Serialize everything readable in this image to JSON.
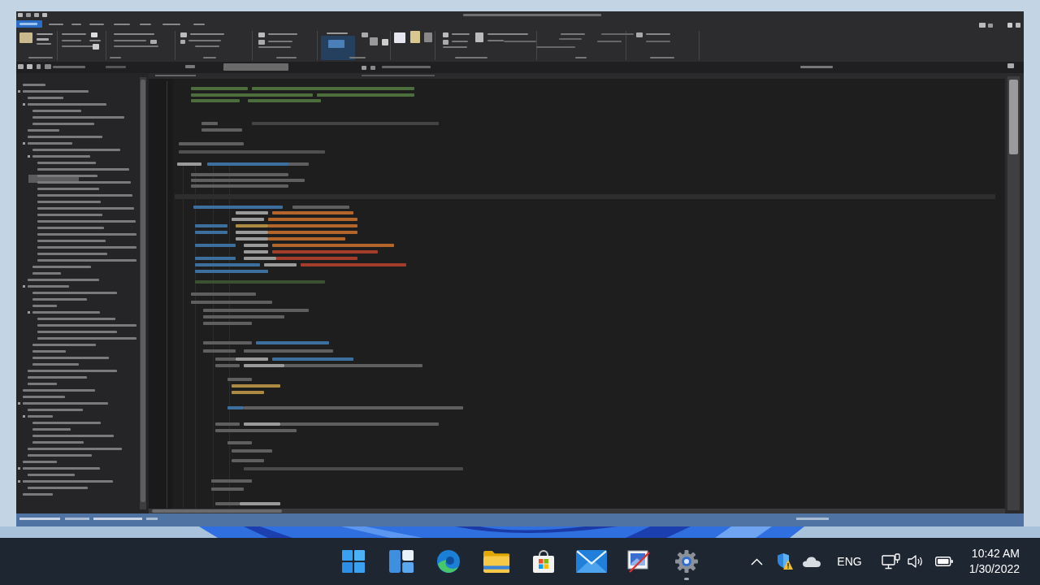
{
  "taskbar": {
    "apps": [
      {
        "kind": "start",
        "running": false
      },
      {
        "kind": "widgets",
        "running": false
      },
      {
        "kind": "browser",
        "running": false
      },
      {
        "kind": "files",
        "running": false
      },
      {
        "kind": "store",
        "running": false
      },
      {
        "kind": "mail",
        "running": false
      },
      {
        "kind": "paint",
        "running": false
      },
      {
        "kind": "settings",
        "running": true
      }
    ],
    "tray": {
      "language": "ENG",
      "time": "10:42 AM",
      "date": "1/30/2022"
    }
  }
}
